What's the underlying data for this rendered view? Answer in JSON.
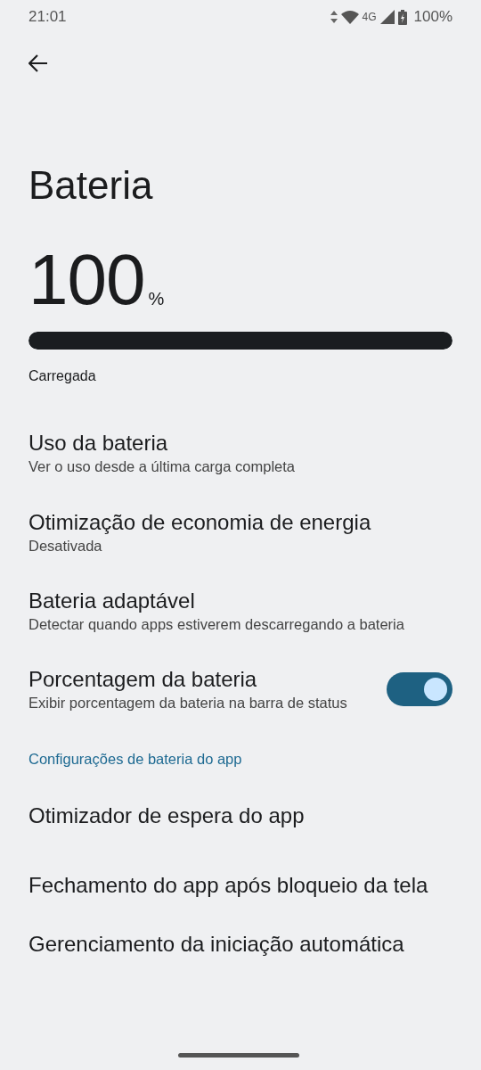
{
  "status_bar": {
    "time": "21:01",
    "network": "4G",
    "battery": "100%"
  },
  "title": "Bateria",
  "battery": {
    "value": "100",
    "unit": "%",
    "level": 1,
    "status": "Carregada"
  },
  "items": [
    {
      "kind": "item",
      "title": "Uso da bateria",
      "subtitle": "Ver o uso desde a última carga completa"
    },
    {
      "kind": "item",
      "title": "Otimização de economia de energia",
      "subtitle": "Desativada"
    },
    {
      "kind": "item",
      "title": "Bateria adaptável",
      "subtitle": "Detectar quando apps estiverem descarregando a bateria"
    },
    {
      "kind": "toggle",
      "title": "Porcentagem da bateria",
      "subtitle": "Exibir porcentagem da bateria na barra de status",
      "on": true
    },
    {
      "kind": "header",
      "title": "Configurações de bateria do app"
    },
    {
      "kind": "item",
      "title": "Otimizador de espera do app"
    },
    {
      "kind": "item",
      "title": "Fechamento do app após bloqueio da tela"
    },
    {
      "kind": "item",
      "title": "Gerenciamento da iniciação automática"
    }
  ]
}
